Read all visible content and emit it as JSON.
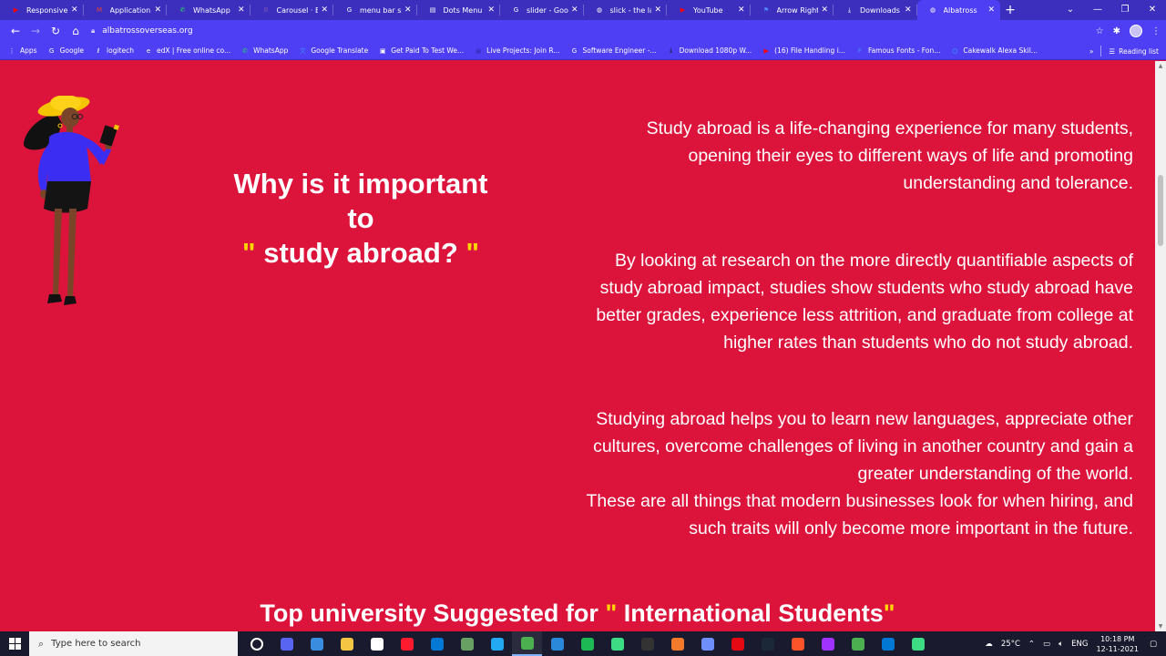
{
  "browser": {
    "tabs": [
      {
        "label": "Responsive Sl",
        "icon": "youtube-icon",
        "color": "#ff0000",
        "active": false
      },
      {
        "label": "Application fo",
        "icon": "gmail-icon",
        "color": "#ea4335",
        "active": false
      },
      {
        "label": "WhatsApp",
        "icon": "whatsapp-icon",
        "color": "#25d366",
        "active": false
      },
      {
        "label": "Carousel · Boo",
        "icon": "bootstrap-icon",
        "color": "#7952b3",
        "active": false
      },
      {
        "label": "menu bar ssw",
        "icon": "google-icon",
        "color": "#ffffff",
        "active": false
      },
      {
        "label": "Dots Menu Ve",
        "icon": "page-icon",
        "color": "#ffffff",
        "active": false
      },
      {
        "label": "slider - Googl",
        "icon": "google-icon",
        "color": "#ffffff",
        "active": false
      },
      {
        "label": "slick - the last",
        "icon": "globe-icon",
        "color": "#ffffff",
        "active": false
      },
      {
        "label": "YouTube",
        "icon": "youtube-icon",
        "color": "#ff0000",
        "active": false
      },
      {
        "label": "Arrow Right Ic",
        "icon": "flag-icon",
        "color": "#4f8cff",
        "active": false
      },
      {
        "label": "Downloads",
        "icon": "download-icon",
        "color": "#ffffff",
        "active": false
      },
      {
        "label": "Albatross",
        "icon": "globe-icon",
        "color": "#ffffff",
        "active": true
      }
    ],
    "url": "albatrossoverseas.org",
    "bookmarks": [
      {
        "label": "Apps",
        "icon": "apps-icon",
        "color": "#ffffff"
      },
      {
        "label": "Google",
        "icon": "google-icon",
        "color": "#ffffff"
      },
      {
        "label": "logitech",
        "icon": "logitech-icon",
        "color": "#ffffff"
      },
      {
        "label": "edX | Free online co...",
        "icon": "edx-icon",
        "color": "#ffffff"
      },
      {
        "label": "WhatsApp",
        "icon": "whatsapp-icon",
        "color": "#25d366"
      },
      {
        "label": "Google Translate",
        "icon": "translate-icon",
        "color": "#4285f4"
      },
      {
        "label": "Get Paid To Test We...",
        "icon": "bookmark-icon",
        "color": "#ffffff"
      },
      {
        "label": "Live Projects: Join R...",
        "icon": "bookmark-icon",
        "color": "#3a2dc0"
      },
      {
        "label": "Software Engineer -...",
        "icon": "google-icon",
        "color": "#ffffff"
      },
      {
        "label": "Download 1080p W...",
        "icon": "download-icon",
        "color": "#111111"
      },
      {
        "label": "(16) File Handling i...",
        "icon": "youtube-icon",
        "color": "#ff0000"
      },
      {
        "label": "Famous Fonts - Fon...",
        "icon": "font-icon",
        "color": "#4f8cff"
      },
      {
        "label": "Cakewalk Alexa Skil...",
        "icon": "alexa-icon",
        "color": "#31c4f3"
      }
    ],
    "reading_list": "Reading list"
  },
  "content": {
    "heading": {
      "line1": "Why is it important",
      "line2": "to",
      "quote_open": "\"",
      "line3": "study abroad?",
      "quote_close": "\""
    },
    "paragraphs": [
      "Study abroad is a life-changing experience for many students, opening their eyes to different ways of life and promoting understanding and tolerance.",
      "By looking at research on the more directly quantifiable aspects of study abroad impact, studies show students who study abroad have better grades, experience less attrition, and graduate from college at higher rates than students who do not study abroad.",
      "Studying abroad helps you to learn new languages, appreciate other cultures, overcome challenges of living in another country and gain a greater understanding of the world.",
      "These are all things that modern businesses look for when hiring, and such traits will only become more important in the future."
    ],
    "bottom_heading": {
      "prefix": "Top university Suggested for",
      "quote_open": "\"",
      "highlight": "International Students",
      "quote_close": "\""
    }
  },
  "taskbar": {
    "search_placeholder": "Type here to search",
    "apps": [
      {
        "icon": "task-view-icon",
        "color": "#ffffff"
      },
      {
        "icon": "discord-icon",
        "color": "#5865f2"
      },
      {
        "icon": "file-icon",
        "color": "#3a8dde"
      },
      {
        "icon": "file-explorer-icon",
        "color": "#f4c542"
      },
      {
        "icon": "store-icon",
        "color": "#ffffff"
      },
      {
        "icon": "opera-icon",
        "color": "#ff1b2d"
      },
      {
        "icon": "mail-icon",
        "color": "#0078d4"
      },
      {
        "icon": "nodejs-icon",
        "color": "#68a063"
      },
      {
        "icon": "vscode-icon",
        "color": "#23a9f2"
      },
      {
        "icon": "chrome-icon",
        "color": "#4caf50"
      },
      {
        "icon": "todo-icon",
        "color": "#2b88d8"
      },
      {
        "icon": "spotify-icon",
        "color": "#1db954"
      },
      {
        "icon": "chrome-profile-icon",
        "color": "#3ddc84"
      },
      {
        "icon": "epic-games-icon",
        "color": "#333333"
      },
      {
        "icon": "blender-icon",
        "color": "#f5792a"
      },
      {
        "icon": "settings-app-icon",
        "color": "#6e8efb"
      },
      {
        "icon": "netflix-icon",
        "color": "#e50914"
      },
      {
        "icon": "steam-icon",
        "color": "#1b2838"
      },
      {
        "icon": "brave-icon",
        "color": "#fb542b"
      },
      {
        "icon": "messenger-icon",
        "color": "#a033ff"
      },
      {
        "icon": "chrome-icon",
        "color": "#4caf50"
      },
      {
        "icon": "media-player-icon",
        "color": "#0078d4"
      },
      {
        "icon": "chrome-profile-icon",
        "color": "#3ddc84"
      }
    ],
    "temperature": "25°C",
    "language": "ENG",
    "time": "10:18 PM",
    "date": "12-11-2021"
  }
}
